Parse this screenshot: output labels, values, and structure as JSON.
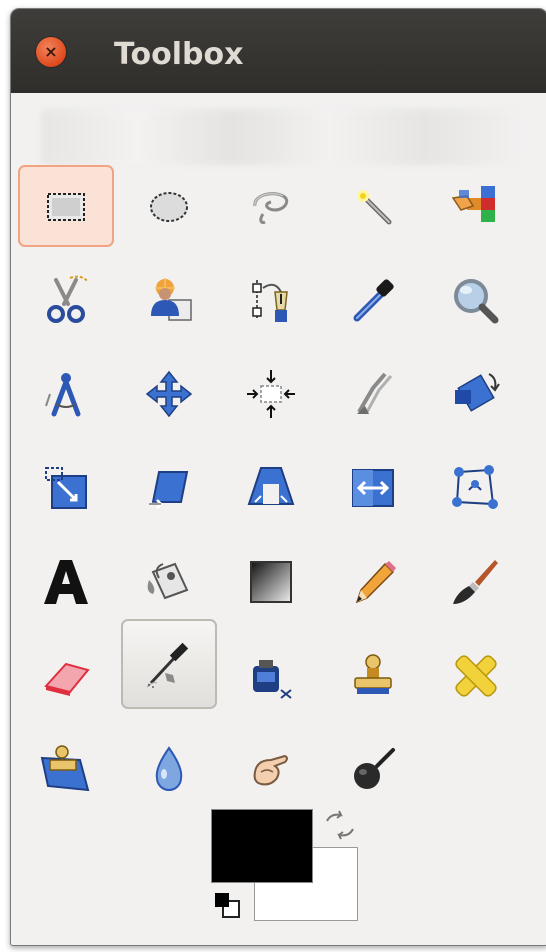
{
  "window": {
    "title": "Toolbox",
    "close_glyph": "×"
  },
  "tools": [
    {
      "name": "rect-select-icon",
      "active": true
    },
    {
      "name": "ellipse-select-icon"
    },
    {
      "name": "free-select-icon"
    },
    {
      "name": "fuzzy-select-icon"
    },
    {
      "name": "select-by-color-icon"
    },
    {
      "name": "scissors-select-icon"
    },
    {
      "name": "foreground-select-icon"
    },
    {
      "name": "paths-icon"
    },
    {
      "name": "color-picker-icon"
    },
    {
      "name": "zoom-icon"
    },
    {
      "name": "measure-icon"
    },
    {
      "name": "move-icon"
    },
    {
      "name": "alignment-icon"
    },
    {
      "name": "crop-icon"
    },
    {
      "name": "rotate-icon"
    },
    {
      "name": "scale-icon"
    },
    {
      "name": "shear-icon"
    },
    {
      "name": "perspective-icon"
    },
    {
      "name": "flip-icon"
    },
    {
      "name": "cage-transform-icon"
    },
    {
      "name": "text-icon"
    },
    {
      "name": "bucket-fill-icon"
    },
    {
      "name": "blend-icon"
    },
    {
      "name": "pencil-icon"
    },
    {
      "name": "paintbrush-icon"
    },
    {
      "name": "eraser-icon"
    },
    {
      "name": "airbrush-icon",
      "hover": true
    },
    {
      "name": "ink-icon"
    },
    {
      "name": "clone-icon"
    },
    {
      "name": "heal-icon"
    },
    {
      "name": "perspective-clone-icon"
    },
    {
      "name": "blur-sharpen-icon"
    },
    {
      "name": "smudge-icon"
    },
    {
      "name": "dodge-burn-icon"
    }
  ],
  "colors": {
    "foreground": "#000000",
    "background": "#ffffff",
    "titlebar": "#3c3b37",
    "active_tool_bg": "#fbe2d6"
  }
}
